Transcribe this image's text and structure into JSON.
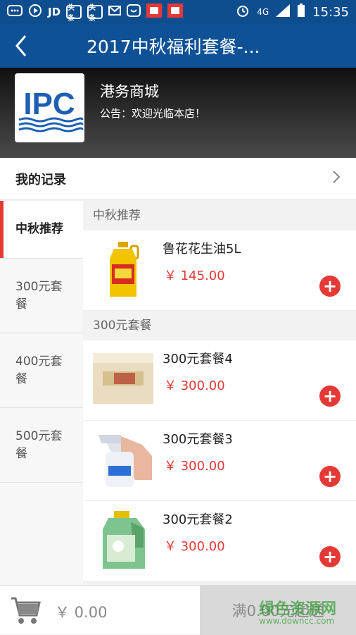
{
  "status_bar": {
    "left_labels": [
      "JD",
      "头条",
      "头条"
    ],
    "network": "4G",
    "time": "15:35"
  },
  "header": {
    "back_icon": "chevron-left-icon",
    "title": "2017中秋福利套餐-..."
  },
  "shop": {
    "logo_text": "IPC",
    "name": "港务商城",
    "notice": "公告：欢迎光临本店！"
  },
  "records": {
    "label": "我的记录"
  },
  "sidebar": {
    "items": [
      {
        "label": "中秋推荐",
        "active": true
      },
      {
        "label": "300元套餐",
        "active": false
      },
      {
        "label": "400元套餐",
        "active": false
      },
      {
        "label": "500元套餐",
        "active": false
      }
    ]
  },
  "sections": [
    {
      "title": "中秋推荐",
      "products": [
        {
          "name": "鲁花花生油5L",
          "price": "￥ 145.00"
        }
      ]
    },
    {
      "title": "300元套餐",
      "products": [
        {
          "name": "300元套餐4",
          "price": "￥ 300.00"
        },
        {
          "name": "300元套餐3",
          "price": "￥ 300.00"
        },
        {
          "name": "300元套餐2",
          "price": "￥ 300.00"
        }
      ]
    }
  ],
  "footer": {
    "total": "￥ 0.00",
    "checkout": "满0.00元起送"
  },
  "watermark": {
    "text": "绿色资源网",
    "url": "www.downcc.com"
  },
  "colors": {
    "header_blue": "#0e5196",
    "accent_red": "#e53935"
  }
}
